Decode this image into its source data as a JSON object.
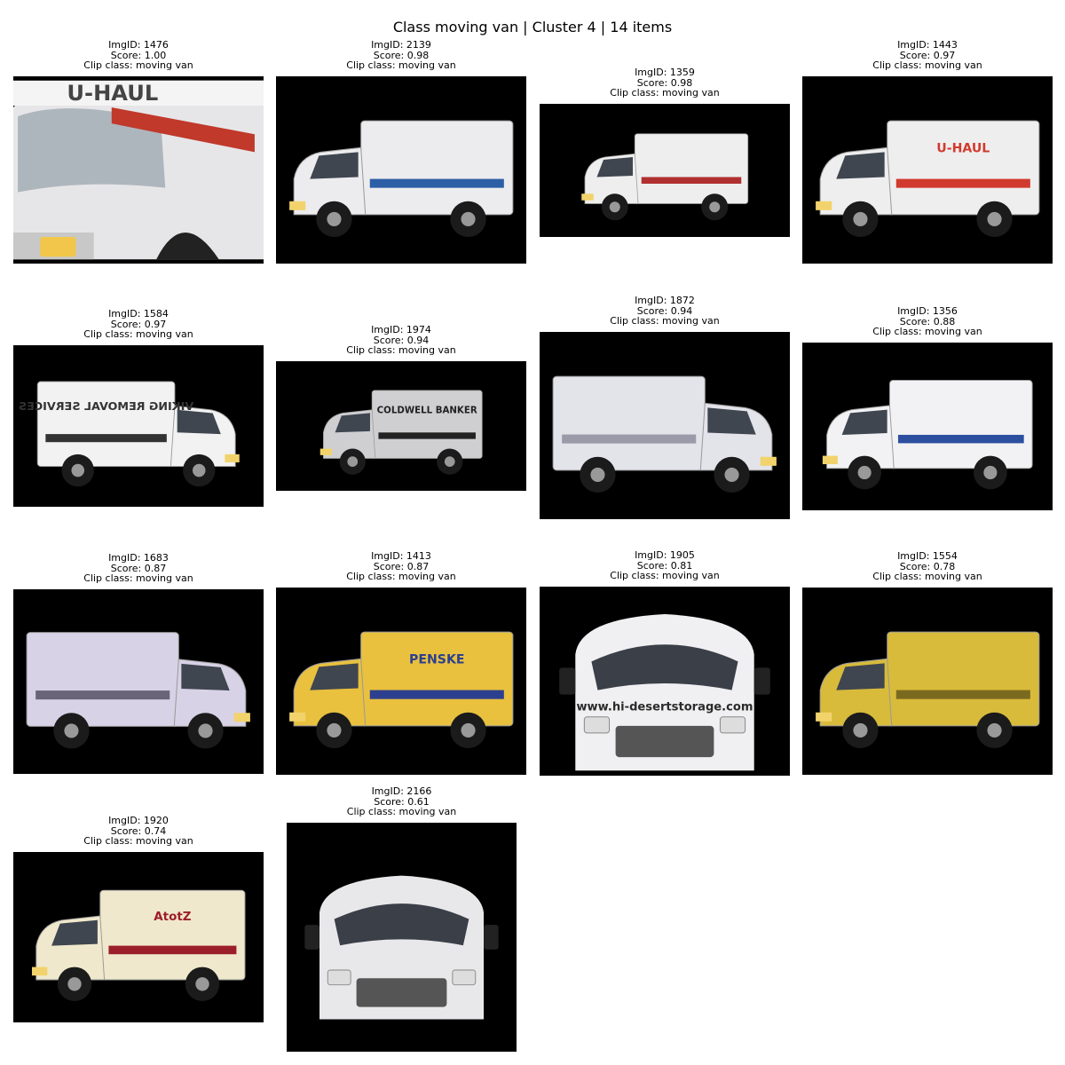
{
  "figure_title": "Class moving van | Cluster 4 | 14 items",
  "items": [
    {
      "img_id": "ImgID: 1476",
      "score": "Score: 1.00",
      "clip_class": "Clip class: moving van",
      "van_color": "#e6e6e8",
      "accent": "#c0392b",
      "lettering": "U-HAUL",
      "view": "closeup"
    },
    {
      "img_id": "ImgID: 2139",
      "score": "Score: 0.98",
      "clip_class": "Clip class: moving van",
      "van_color": "#ececee",
      "accent": "#2d5fa6",
      "lettering": "",
      "view": "left"
    },
    {
      "img_id": "ImgID: 1359",
      "score": "Score: 0.98",
      "clip_class": "Clip class: moving van",
      "van_color": "#eeeeee",
      "accent": "#b03030",
      "lettering": "",
      "view": "left"
    },
    {
      "img_id": "ImgID: 1443",
      "score": "Score: 0.97",
      "clip_class": "Clip class: moving van",
      "van_color": "#eeeeee",
      "accent": "#d13a2e",
      "lettering": "U-HAUL",
      "view": "left"
    },
    {
      "img_id": "ImgID: 1584",
      "score": "Score: 0.97",
      "clip_class": "Clip class: moving van",
      "van_color": "#f2f2f2",
      "accent": "#333333",
      "lettering": "VIKING REMOVAL SERVICES",
      "view": "right"
    },
    {
      "img_id": "ImgID: 1974",
      "score": "Score: 0.94",
      "clip_class": "Clip class: moving van",
      "van_color": "#cfcfd2",
      "accent": "#222222",
      "lettering": "COLDWELL BANKER",
      "view": "left"
    },
    {
      "img_id": "ImgID: 1872",
      "score": "Score: 0.94",
      "clip_class": "Clip class: moving van",
      "van_color": "#e3e3ea",
      "accent": "#9a9aa8",
      "lettering": "",
      "view": "right"
    },
    {
      "img_id": "ImgID: 1356",
      "score": "Score: 0.88",
      "clip_class": "Clip class: moving van",
      "van_color": "#f2f2f4",
      "accent": "#2d4fa0",
      "lettering": "",
      "view": "left"
    },
    {
      "img_id": "ImgID: 1683",
      "score": "Score: 0.87",
      "clip_class": "Clip class: moving van",
      "van_color": "#d8d2e6",
      "accent": "#6a6478",
      "lettering": "",
      "view": "right"
    },
    {
      "img_id": "ImgID: 1413",
      "score": "Score: 0.87",
      "clip_class": "Clip class: moving van",
      "van_color": "#e9c13e",
      "accent": "#2d3f8f",
      "lettering": "PENSKE",
      "view": "left"
    },
    {
      "img_id": "ImgID: 1905",
      "score": "Score: 0.81",
      "clip_class": "Clip class: moving van",
      "van_color": "#f0f0f2",
      "accent": "#2b2b2b",
      "lettering": "www.hi-desertstorage.com",
      "view": "front"
    },
    {
      "img_id": "ImgID: 1554",
      "score": "Score: 0.78",
      "clip_class": "Clip class: moving van",
      "van_color": "#d8bb3a",
      "accent": "#7a6a20",
      "lettering": "",
      "view": "left"
    },
    {
      "img_id": "ImgID: 1920",
      "score": "Score: 0.74",
      "clip_class": "Clip class: moving van",
      "van_color": "#f0e8cc",
      "accent": "#9b1f2a",
      "lettering": "AtotZ",
      "view": "left"
    },
    {
      "img_id": "ImgID: 2166",
      "score": "Score: 0.61",
      "clip_class": "Clip class: moving van",
      "van_color": "#e8e8ea",
      "accent": "#c0392b",
      "lettering": "",
      "view": "front"
    }
  ]
}
